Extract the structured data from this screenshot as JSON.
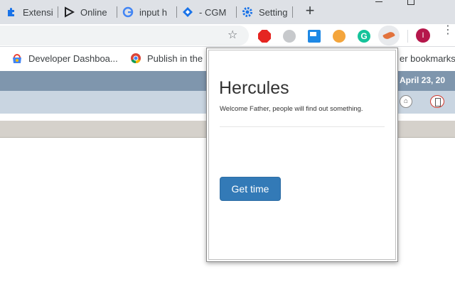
{
  "browser": {
    "tabs": [
      {
        "label": "Extensi",
        "icon": "puzzle-icon"
      },
      {
        "label": "Online",
        "icon": "play-icon"
      },
      {
        "label": "input h",
        "icon": "google-icon"
      },
      {
        "label": "- CGM",
        "icon": "diamond-icon"
      },
      {
        "label": "Setting",
        "icon": "gear-icon"
      }
    ],
    "new_tab_label": "+",
    "profile_initial": "I",
    "grammarly_letter": "G",
    "menu_glyph": "⋮"
  },
  "bookmarks": {
    "items": [
      {
        "label": "Developer Dashboa...",
        "icon": "chrome-webstore-icon"
      },
      {
        "label": "Publish in the",
        "icon": "chrome-icon"
      }
    ],
    "other_label": "er bookmarks"
  },
  "page": {
    "date": "April 23, 20"
  },
  "popup": {
    "title": "Hercules",
    "subtitle": "Welcome Father, people will find out something.",
    "button_label": "Get time"
  },
  "colors": {
    "button_primary": "#337ab7",
    "tabstrip": "#dee1e6",
    "page_band": "#7f96ad"
  }
}
